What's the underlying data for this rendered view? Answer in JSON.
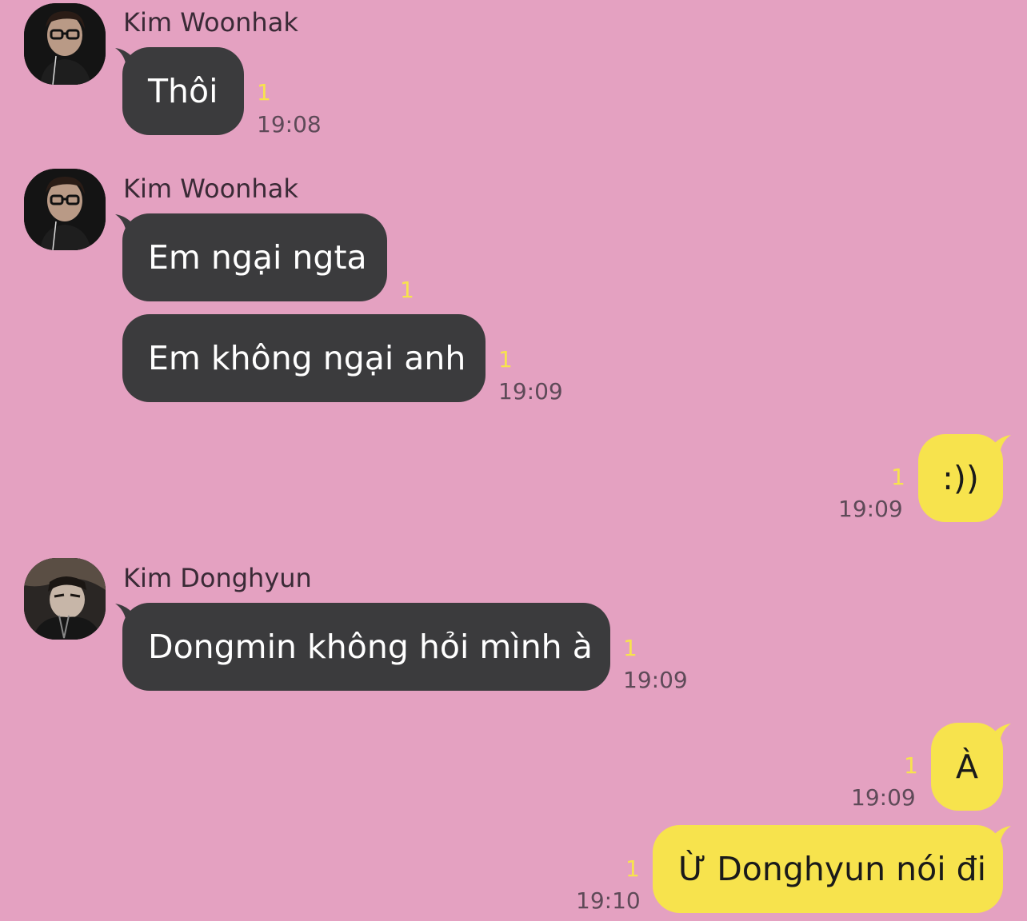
{
  "colors": {
    "background": "#e4a1c1",
    "incoming_bubble": "#3b3b3d",
    "outgoing_bubble": "#f7e34d",
    "unread_count": "#f7e34d"
  },
  "messages": [
    {
      "sender": "Kim Woonhak",
      "text": "Thôi",
      "unread": "1",
      "time": "19:08"
    },
    {
      "sender": "Kim Woonhak",
      "text": "Em ngại ngta",
      "unread": "1"
    },
    {
      "text": "Em không ngại anh",
      "unread": "1",
      "time": "19:09"
    },
    {
      "text": ":))",
      "unread": "1",
      "time": "19:09"
    },
    {
      "sender": "Kim Donghyun",
      "text": "Dongmin không hỏi mình à",
      "unread": "1",
      "time": "19:09"
    },
    {
      "text": "À",
      "unread": "1",
      "time": "19:09"
    },
    {
      "text": "Ừ Donghyun nói đi",
      "unread": "1",
      "time": "19:10"
    }
  ]
}
